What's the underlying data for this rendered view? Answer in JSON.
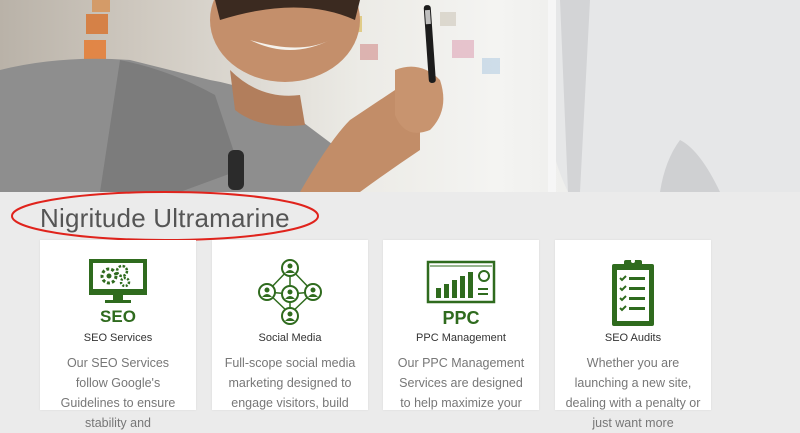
{
  "hero": {
    "icon": "man-with-pen-photo"
  },
  "heading": {
    "title": "Nigritude Ultramarine",
    "annotation_color": "#e0231c"
  },
  "brand_color": "#2f6b1e",
  "cards": [
    {
      "icon": "seo-monitor-gears-icon",
      "icon_text": "SEO",
      "title": "SEO Services",
      "text": "Our SEO Services follow Google's Guidelines to ensure stability and"
    },
    {
      "icon": "social-network-icon",
      "title": "Social Media",
      "text": "Full-scope social media marketing designed to engage visitors, build"
    },
    {
      "icon": "ppc-chart-icon",
      "icon_text": "PPC",
      "title": "PPC Management",
      "text": "Our PPC Management Services are designed to help maximize your"
    },
    {
      "icon": "clipboard-checklist-icon",
      "title": "SEO Audits",
      "text": "Whether you are launching a new site, dealing with a penalty or just want more"
    }
  ]
}
